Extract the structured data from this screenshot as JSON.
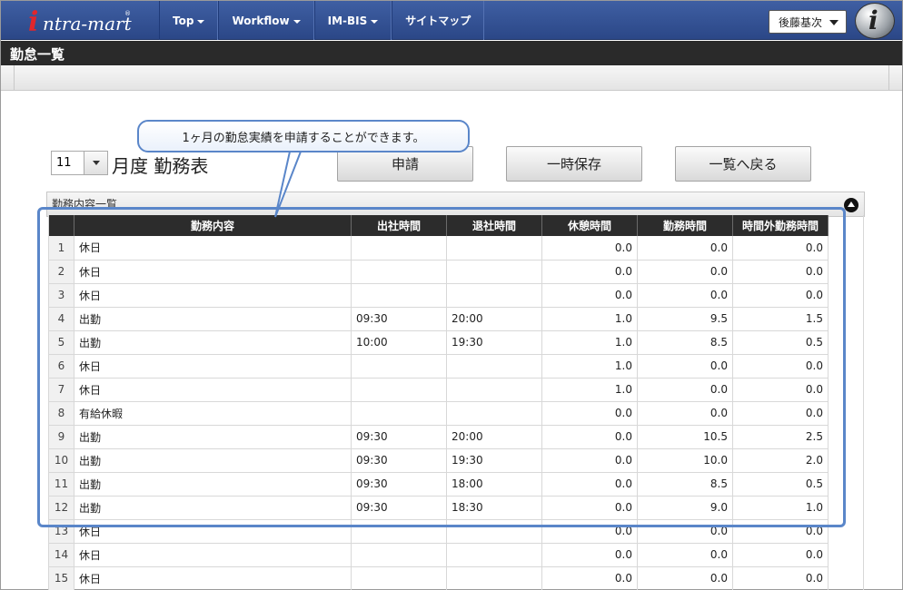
{
  "brand": {
    "logo_text": "intra-mart",
    "logo_registered": "®"
  },
  "nav": {
    "items": [
      {
        "label": "Top"
      },
      {
        "label": "Workflow"
      },
      {
        "label": "IM-BIS"
      },
      {
        "label": "サイトマップ"
      }
    ]
  },
  "user": {
    "name": "後藤基次"
  },
  "page": {
    "title": "勤怠一覧"
  },
  "controls": {
    "month": "11",
    "heading": "月度 勤務表",
    "submit_label": "申請",
    "save_label": "一時保存",
    "back_label": "一覧へ戻る"
  },
  "callout": {
    "text": "1ヶ月の勤怠実績を申請することができます。"
  },
  "panel": {
    "title": "勤務内容一覧"
  },
  "table": {
    "headers": [
      "",
      "勤務内容",
      "出社時間",
      "退社時間",
      "休憩時間",
      "勤務時間",
      "時間外勤務時間"
    ],
    "rows": [
      {
        "no": "1",
        "content": "休日",
        "start": "",
        "end": "",
        "break": "0.0",
        "work": "0.0",
        "overtime": "0.0"
      },
      {
        "no": "2",
        "content": "休日",
        "start": "",
        "end": "",
        "break": "0.0",
        "work": "0.0",
        "overtime": "0.0"
      },
      {
        "no": "3",
        "content": "休日",
        "start": "",
        "end": "",
        "break": "0.0",
        "work": "0.0",
        "overtime": "0.0"
      },
      {
        "no": "4",
        "content": "出勤",
        "start": "09:30",
        "end": "20:00",
        "break": "1.0",
        "work": "9.5",
        "overtime": "1.5"
      },
      {
        "no": "5",
        "content": "出勤",
        "start": "10:00",
        "end": "19:30",
        "break": "1.0",
        "work": "8.5",
        "overtime": "0.5"
      },
      {
        "no": "6",
        "content": "休日",
        "start": "",
        "end": "",
        "break": "1.0",
        "work": "0.0",
        "overtime": "0.0"
      },
      {
        "no": "7",
        "content": "休日",
        "start": "",
        "end": "",
        "break": "1.0",
        "work": "0.0",
        "overtime": "0.0"
      },
      {
        "no": "8",
        "content": "有給休暇",
        "start": "",
        "end": "",
        "break": "0.0",
        "work": "0.0",
        "overtime": "0.0"
      },
      {
        "no": "9",
        "content": "出勤",
        "start": "09:30",
        "end": "20:00",
        "break": "0.0",
        "work": "10.5",
        "overtime": "2.5"
      },
      {
        "no": "10",
        "content": "出勤",
        "start": "09:30",
        "end": "19:30",
        "break": "0.0",
        "work": "10.0",
        "overtime": "2.0"
      },
      {
        "no": "11",
        "content": "出勤",
        "start": "09:30",
        "end": "18:00",
        "break": "0.0",
        "work": "8.5",
        "overtime": "0.5"
      },
      {
        "no": "12",
        "content": "出勤",
        "start": "09:30",
        "end": "18:30",
        "break": "0.0",
        "work": "9.0",
        "overtime": "1.0"
      },
      {
        "no": "13",
        "content": "休日",
        "start": "",
        "end": "",
        "break": "0.0",
        "work": "0.0",
        "overtime": "0.0"
      },
      {
        "no": "14",
        "content": "休日",
        "start": "",
        "end": "",
        "break": "0.0",
        "work": "0.0",
        "overtime": "0.0"
      },
      {
        "no": "15",
        "content": "休日",
        "start": "",
        "end": "",
        "break": "0.0",
        "work": "0.0",
        "overtime": "0.0"
      }
    ]
  }
}
